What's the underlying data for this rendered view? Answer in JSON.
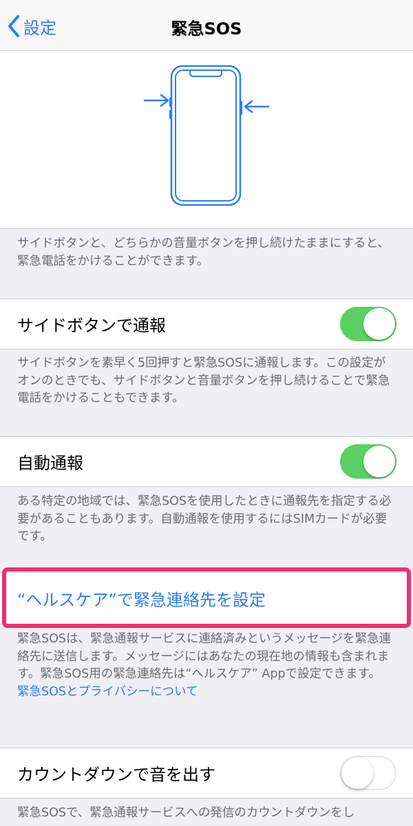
{
  "navbar": {
    "back_label": "設定",
    "title": "緊急SOS"
  },
  "colors": {
    "accent": "#2e7cf6",
    "toggle_on": "#5ad162",
    "highlight": "#ef2f6e"
  },
  "illustration": {
    "icons": [
      "phone-outline",
      "arrow-right",
      "arrow-left"
    ]
  },
  "intro_note": "サイドボタンと、どちらかの音量ボタンを押し続けたままにすると、緊急電話をかけることができます。",
  "call_with_side_button": {
    "label": "サイドボタンで通報",
    "enabled": true,
    "note": "サイドボタンを素早く5回押すと緊急SOSに通報します。この設定がオンのときでも、サイドボタンと音量ボタンを押し続けることで緊急電話をかけることもできます。"
  },
  "auto_call": {
    "label": "自動通報",
    "enabled": true,
    "note": "ある特定の地域では、緊急SOSを使用したときに通報先を指定する必要があることもあります。自動通報を使用するにはSIMカードが必要です。"
  },
  "health_contacts": {
    "label": "“ヘルスケア”で緊急連絡先を設定",
    "note": "緊急SOSは、緊急通報サービスに連絡済みというメッセージを緊急連絡先に送信します。メッセージにはあなたの現在地の情報も含まれます。緊急SOS用の緊急連絡先は“ヘルスケア” Appで設定できます。",
    "privacy_link": "緊急SOSとプライバシーについて"
  },
  "countdown_sound": {
    "label": "カウントダウンで音を出す",
    "enabled": false,
    "note_partial": "緊急SOSで、緊急通報サービスへの発信のカウントダウンをし"
  }
}
